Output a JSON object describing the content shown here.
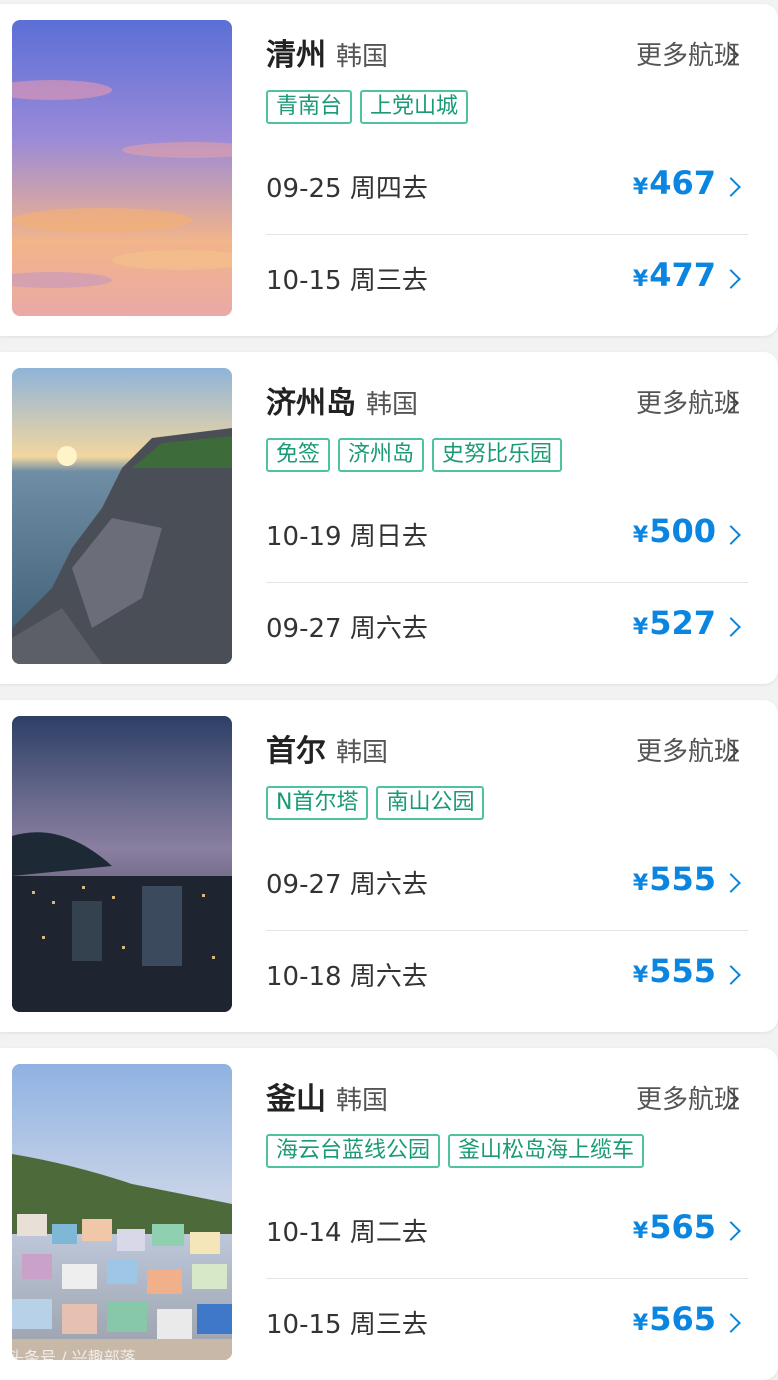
{
  "more_flights_label": "更多航班",
  "currency_symbol": "¥",
  "destinations": [
    {
      "city": "清州",
      "country": "韩国",
      "tags": [
        "青南台",
        "上党山城"
      ],
      "flights": [
        {
          "date": "09-25 周四去",
          "price": "467"
        },
        {
          "date": "10-15 周三去",
          "price": "477"
        }
      ]
    },
    {
      "city": "济州岛",
      "country": "韩国",
      "tags": [
        "免签",
        "济州岛",
        "史努比乐园"
      ],
      "flights": [
        {
          "date": "10-19 周日去",
          "price": "500"
        },
        {
          "date": "09-27 周六去",
          "price": "527"
        }
      ]
    },
    {
      "city": "首尔",
      "country": "韩国",
      "tags": [
        "N首尔塔",
        "南山公园"
      ],
      "flights": [
        {
          "date": "09-27 周六去",
          "price": "555"
        },
        {
          "date": "10-18 周六去",
          "price": "555"
        }
      ]
    },
    {
      "city": "釜山",
      "country": "韩国",
      "tags": [
        "海云台蓝线公园",
        "釜山松岛海上缆车"
      ],
      "flights": [
        {
          "date": "10-14 周二去",
          "price": "565"
        },
        {
          "date": "10-15 周三去",
          "price": "565"
        }
      ]
    }
  ],
  "watermark": "头条号 / 兴趣部落"
}
